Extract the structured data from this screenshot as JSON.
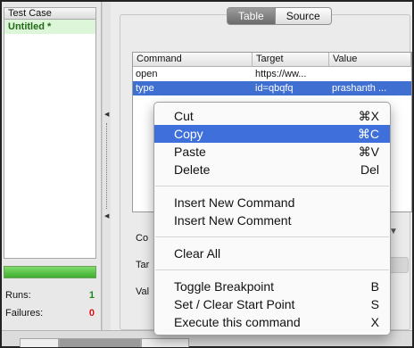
{
  "left": {
    "header": "Test Case",
    "items": [
      "Untitled *"
    ],
    "runs_label": "Runs:",
    "runs_value": "1",
    "failures_label": "Failures:",
    "failures_value": "0",
    "progress": 1.0
  },
  "tabs": {
    "table": "Table",
    "source": "Source",
    "active": "Table"
  },
  "table": {
    "headers": [
      "Command",
      "Target",
      "Value"
    ],
    "rows": [
      {
        "command": "open",
        "target": "https://ww...",
        "value": ""
      },
      {
        "command": "type",
        "target": "id=qbqfq",
        "value": "prashanth ..."
      }
    ],
    "selected_row": 1
  },
  "form": {
    "command_label": "Co",
    "target_label": "Tar",
    "value_label": "Val",
    "select_arrow": "▼"
  },
  "menu": {
    "items": [
      {
        "label": "Cut",
        "shortcut": "⌘X"
      },
      {
        "label": "Copy",
        "shortcut": "⌘C"
      },
      {
        "label": "Paste",
        "shortcut": "⌘V"
      },
      {
        "label": "Delete",
        "shortcut": "Del"
      },
      {
        "label": "Insert New Command",
        "shortcut": ""
      },
      {
        "label": "Insert New Comment",
        "shortcut": ""
      },
      {
        "label": "Clear All",
        "shortcut": ""
      },
      {
        "label": "Toggle Breakpoint",
        "shortcut": "B"
      },
      {
        "label": "Set / Clear Start Point",
        "shortcut": "S"
      },
      {
        "label": "Execute this command",
        "shortcut": "X"
      }
    ],
    "highlighted": "Copy"
  },
  "colors": {
    "selection": "#3f6fd1",
    "highlight": "#3e6fdb",
    "runs": "#1c8a1c",
    "failures": "#d81010",
    "test_case_item": "#ddf6da"
  }
}
